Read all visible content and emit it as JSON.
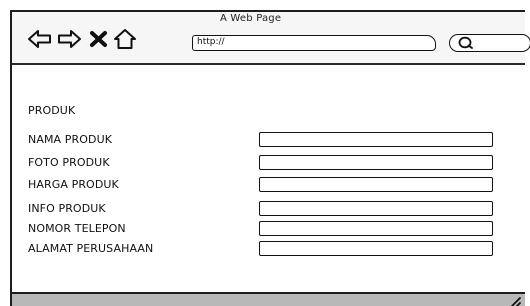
{
  "browser": {
    "title": "A Web Page",
    "url": "http://",
    "search_value": "",
    "nav_icons": [
      "back-arrow-icon",
      "forward-arrow-icon",
      "close-icon",
      "home-icon"
    ],
    "search_icon": "search-magnifier-icon"
  },
  "form": {
    "title": "PRODUK",
    "fields": [
      {
        "label": "NAMA PRODUK",
        "value": ""
      },
      {
        "label": "FOTO PRODUK",
        "value": ""
      },
      {
        "label": "HARGA PRODUK",
        "value": ""
      },
      {
        "label": "INFO PRODUK",
        "value": ""
      },
      {
        "label": "NOMOR TELEPON",
        "value": ""
      },
      {
        "label": "ALAMAT PERUSAHAAN",
        "value": ""
      }
    ]
  },
  "colors": {
    "frame": "#1d1d1d",
    "status_bar": "#b8b8b8",
    "background": "#ffffff"
  }
}
